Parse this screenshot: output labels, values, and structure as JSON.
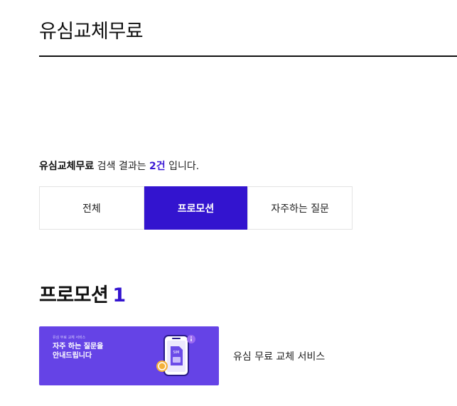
{
  "header": {
    "title": "유심교체무료"
  },
  "search_result": {
    "keyword": "유심교체무료",
    "text_before": " 검색 결과는 ",
    "count": "2건",
    "text_after": " 입니다."
  },
  "tabs": [
    {
      "label": "전체",
      "active": false
    },
    {
      "label": "프로모션",
      "active": true
    },
    {
      "label": "자주하는 질문",
      "active": false
    }
  ],
  "section": {
    "title": "프로모션",
    "count": "1"
  },
  "promotions": [
    {
      "banner_small": "유심 무료 교체 서비스",
      "banner_line1": "자주 하는 질문을",
      "banner_line2": "안내드립니다",
      "name": "유심 무료 교체 서비스",
      "banner_icon": "phone-sim-icon"
    }
  ],
  "colors": {
    "accent": "#3314cf",
    "banner_bg": "#6543e6",
    "coin": "#f4b13b"
  }
}
